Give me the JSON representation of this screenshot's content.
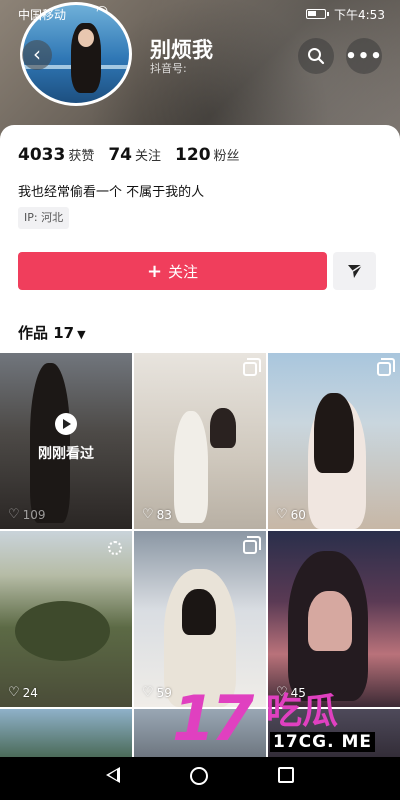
{
  "status_bar": {
    "carrier": "中国移动",
    "time": "下午4:53"
  },
  "profile": {
    "name": "别烦我",
    "douyin_id": "抖音号: ",
    "stats": [
      {
        "value": "4033",
        "label": "获赞"
      },
      {
        "value": "74",
        "label": "关注"
      },
      {
        "value": "120",
        "label": "粉丝"
      }
    ],
    "bio": "我也经常偷看一个 不属于我的人",
    "ip_location": "IP: 河北",
    "follow_label": "关注",
    "works_label": "作品 17"
  },
  "icons": {
    "back": "chevron-left-icon",
    "search": "search-icon",
    "more": "more-dots-icon",
    "send": "send-arrow-icon",
    "multi_image": "multi-image-icon",
    "live_photo": "live-photo-icon",
    "heart": "heart-icon",
    "play": "play-icon"
  },
  "grid": {
    "just_watched_label": "刚刚看过",
    "items": [
      {
        "likes": "109"
      },
      {
        "likes": "83"
      },
      {
        "likes": "60"
      },
      {
        "likes": "24"
      },
      {
        "likes": "59"
      },
      {
        "likes": "45"
      }
    ]
  },
  "watermark": {
    "number": "17",
    "text": "吃瓜",
    "site": "17CG. ME"
  },
  "colors": {
    "follow_button": "#f03e5c",
    "like_text": "#ffffff"
  }
}
